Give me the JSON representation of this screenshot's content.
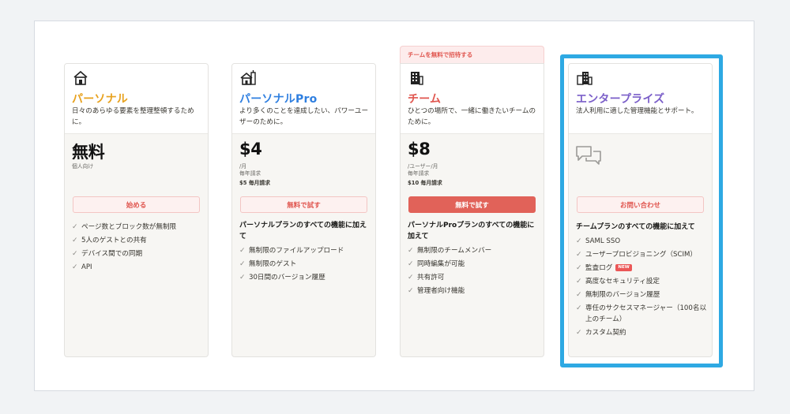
{
  "plans": [
    {
      "name": "パーソナル",
      "name_color": "#e8a21e",
      "icon": "house-icon",
      "description": "日々のあらゆる要素を整理整頓するために。",
      "price": "無料",
      "price_subs": [
        "個人向け"
      ],
      "cta": "始める",
      "cta_style": "outline",
      "features_heading": "",
      "features": [
        "ページ数とブロック数が無制限",
        "5人のゲストとの共有",
        "デバイス間での同期",
        "API"
      ]
    },
    {
      "name": "パーソナルPro",
      "name_color": "#2f7fe0",
      "icon": "house-plus-icon",
      "description": "より多くのことを達成したい、パワーユーザーのために。",
      "price": "$4",
      "price_subs": [
        "/月",
        "毎年請求",
        "$5 毎月請求"
      ],
      "cta": "無料で試す",
      "cta_style": "outline",
      "features_heading": "パーソナルプランのすべての機能に加えて",
      "features": [
        "無制限のファイルアップロード",
        "無制限のゲスト",
        "30日間のバージョン履歴"
      ]
    },
    {
      "name": "チーム",
      "name_color": "#e0564f",
      "icon": "building-icon",
      "banner": "チームを無料で招待する",
      "description": "ひとつの場所で、一緒に働きたいチームのために。",
      "price": "$8",
      "price_subs": [
        "/ユーザー/月",
        "毎年請求",
        "$10 毎月請求"
      ],
      "cta": "無料で試す",
      "cta_style": "solid",
      "features_heading": "パーソナルProプランのすべての機能に加えて",
      "features": [
        "無制限のチームメンバー",
        "同時編集が可能",
        "共有許可",
        "管理者向け機能"
      ]
    },
    {
      "name": "エンタープライズ",
      "name_color": "#7b5fc9",
      "icon": "city-icon",
      "description": "法人利用に適した管理機能とサポート。",
      "price_icon": "chat-bubbles-icon",
      "cta": "お問い合わせ",
      "cta_style": "outline",
      "features_heading": "チームプランのすべての機能に加えて",
      "features": [
        "SAML SSO",
        "ユーザープロビジョニング（SCIM）",
        "監査ログ",
        "高度なセキュリティ設定",
        "無制限のバージョン履歴",
        "専任のサクセスマネージャー（100名以上のチーム）",
        "カスタム契約"
      ],
      "new_badge": "NEW"
    }
  ],
  "colors": {
    "highlight": "#2ea9e3",
    "cta_text": "#e0564f",
    "cta_solid_bg": "#e16259"
  }
}
